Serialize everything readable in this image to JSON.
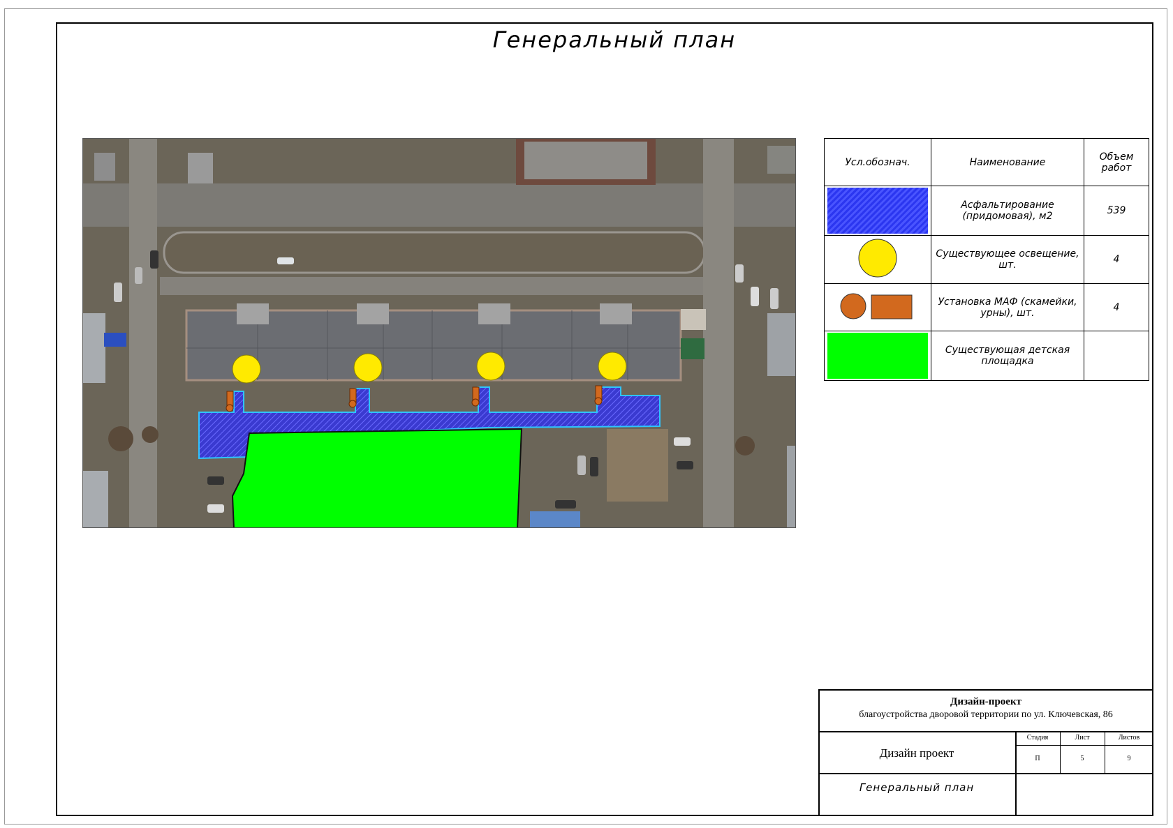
{
  "title": "Генеральный план",
  "legend": {
    "headers": {
      "symbol": "Усл.обознач.",
      "name": "Наименование",
      "volume": "Объем работ"
    },
    "rows": [
      {
        "name": "Асфальтирование (придомовая), м2",
        "volume": "539",
        "symbol": "hatched-blue-rect",
        "color": "#2b36f0"
      },
      {
        "name": "Существующее освещение, шт.",
        "volume": "4",
        "symbol": "yellow-circle-icon",
        "color": "#ffea00"
      },
      {
        "name": "Установка МАФ (скамейки, урны), шт.",
        "volume": "4",
        "symbol": "orange-bench-bin-icon",
        "color": "#d2691e"
      },
      {
        "name": "Существующая детская площадка",
        "volume": "",
        "symbol": "green-rect",
        "color": "#00ff00"
      }
    ]
  },
  "stamp": {
    "project_title": "Дизайн-проект",
    "project_subtitle": "благоустройства дворовой территории по ул. Ключевская, 86",
    "stage_block": "Дизайн проект",
    "sheet_name": "Генеральный план",
    "stage_label": "Стадия",
    "sheet_label": "Лист",
    "sheets_label": "Листов",
    "stage_value": "П",
    "sheet_value": "5",
    "sheets_value": "9"
  },
  "colors": {
    "asphalt": "#2b36f0",
    "lighting": "#ffea00",
    "maf": "#d2691e",
    "playground": "#00ff00"
  }
}
